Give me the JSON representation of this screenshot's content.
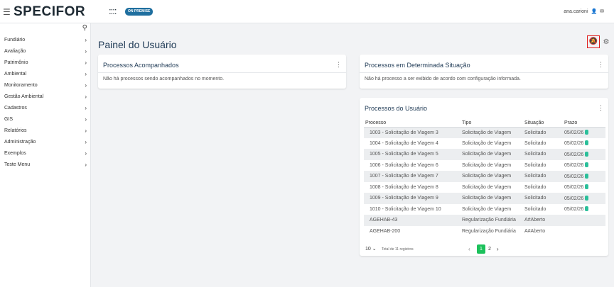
{
  "topbar": {
    "logo": "SPECIFOR",
    "logo_mark": "::::",
    "badge": "ON PREMISE",
    "user": "ana.carioni"
  },
  "sidebar": {
    "items": [
      {
        "label": "Fundiário"
      },
      {
        "label": "Avaliação"
      },
      {
        "label": "Patrimônio"
      },
      {
        "label": "Ambiental"
      },
      {
        "label": "Monitoramento"
      },
      {
        "label": "Gestão Ambiental"
      },
      {
        "label": "Cadastros"
      },
      {
        "label": "GIS"
      },
      {
        "label": "Relatórios"
      },
      {
        "label": "Administração"
      },
      {
        "label": "Exemplos"
      },
      {
        "label": "Teste Menu"
      }
    ]
  },
  "main": {
    "title": "Painel do Usuário"
  },
  "card_acompanhados": {
    "title": "Processos Acompanhados",
    "message": "Não há processos sendo acompanhados no momento."
  },
  "card_situacao": {
    "title": "Processos em Determinada Situação",
    "message": "Não há processo a ser exibido de acordo com configuração informada."
  },
  "card_usuario": {
    "title": "Processos do Usuário",
    "columns": [
      "Processo",
      "Tipo",
      "Situação",
      "Prazo"
    ],
    "rows": [
      {
        "processo": "1003 - Solicitação de Viagem 3",
        "tipo": "Solicitação de Viagem",
        "situacao": "Solicitado",
        "prazo": "05/02/26"
      },
      {
        "processo": "1004 - Solicitação de Viagem 4",
        "tipo": "Solicitação de Viagem",
        "situacao": "Solicitado",
        "prazo": "05/02/26"
      },
      {
        "processo": "1005 - Solicitação de Viagem 5",
        "tipo": "Solicitação de Viagem",
        "situacao": "Solicitado",
        "prazo": "05/02/26"
      },
      {
        "processo": "1006 - Solicitação de Viagem 6",
        "tipo": "Solicitação de Viagem",
        "situacao": "Solicitado",
        "prazo": "05/02/26"
      },
      {
        "processo": "1007 - Solicitação de Viagem 7",
        "tipo": "Solicitação de Viagem",
        "situacao": "Solicitado",
        "prazo": "05/02/26"
      },
      {
        "processo": "1008 - Solicitação de Viagem 8",
        "tipo": "Solicitação de Viagem",
        "situacao": "Solicitado",
        "prazo": "05/02/26"
      },
      {
        "processo": "1009 - Solicitação de Viagem 9",
        "tipo": "Solicitação de Viagem",
        "situacao": "Solicitado",
        "prazo": "05/02/26"
      },
      {
        "processo": "1010 - Solicitação de Viagem 10",
        "tipo": "Solicitação de Viagem",
        "situacao": "Solicitado",
        "prazo": "05/02/26"
      },
      {
        "processo": "AGEHAB-43",
        "tipo": "Regularização Fundiária",
        "situacao": "A#Aberto",
        "prazo": ""
      },
      {
        "processo": "AGEHAB-200",
        "tipo": "Regularização Fundiária",
        "situacao": "A#Aberto",
        "prazo": ""
      }
    ],
    "pager": {
      "per_page": "10",
      "total": "Total de 11 registros",
      "pages": [
        "1",
        "2"
      ]
    }
  },
  "icons": {
    "hamburger": "menu-icon",
    "search": "search-icon",
    "bell": "bell-off-icon",
    "filter": "filter-settings-icon",
    "user": "user-icon",
    "mail": "mail-icon",
    "kebab": "kebab-icon",
    "deadline": "deadline-dot-icon"
  },
  "colors": {
    "accent": "#1f6f9f",
    "title": "#1f3a55",
    "active_page": "#1cc15b",
    "deadline": "#2bbf9a",
    "highlight_border": "#e01b1b"
  }
}
